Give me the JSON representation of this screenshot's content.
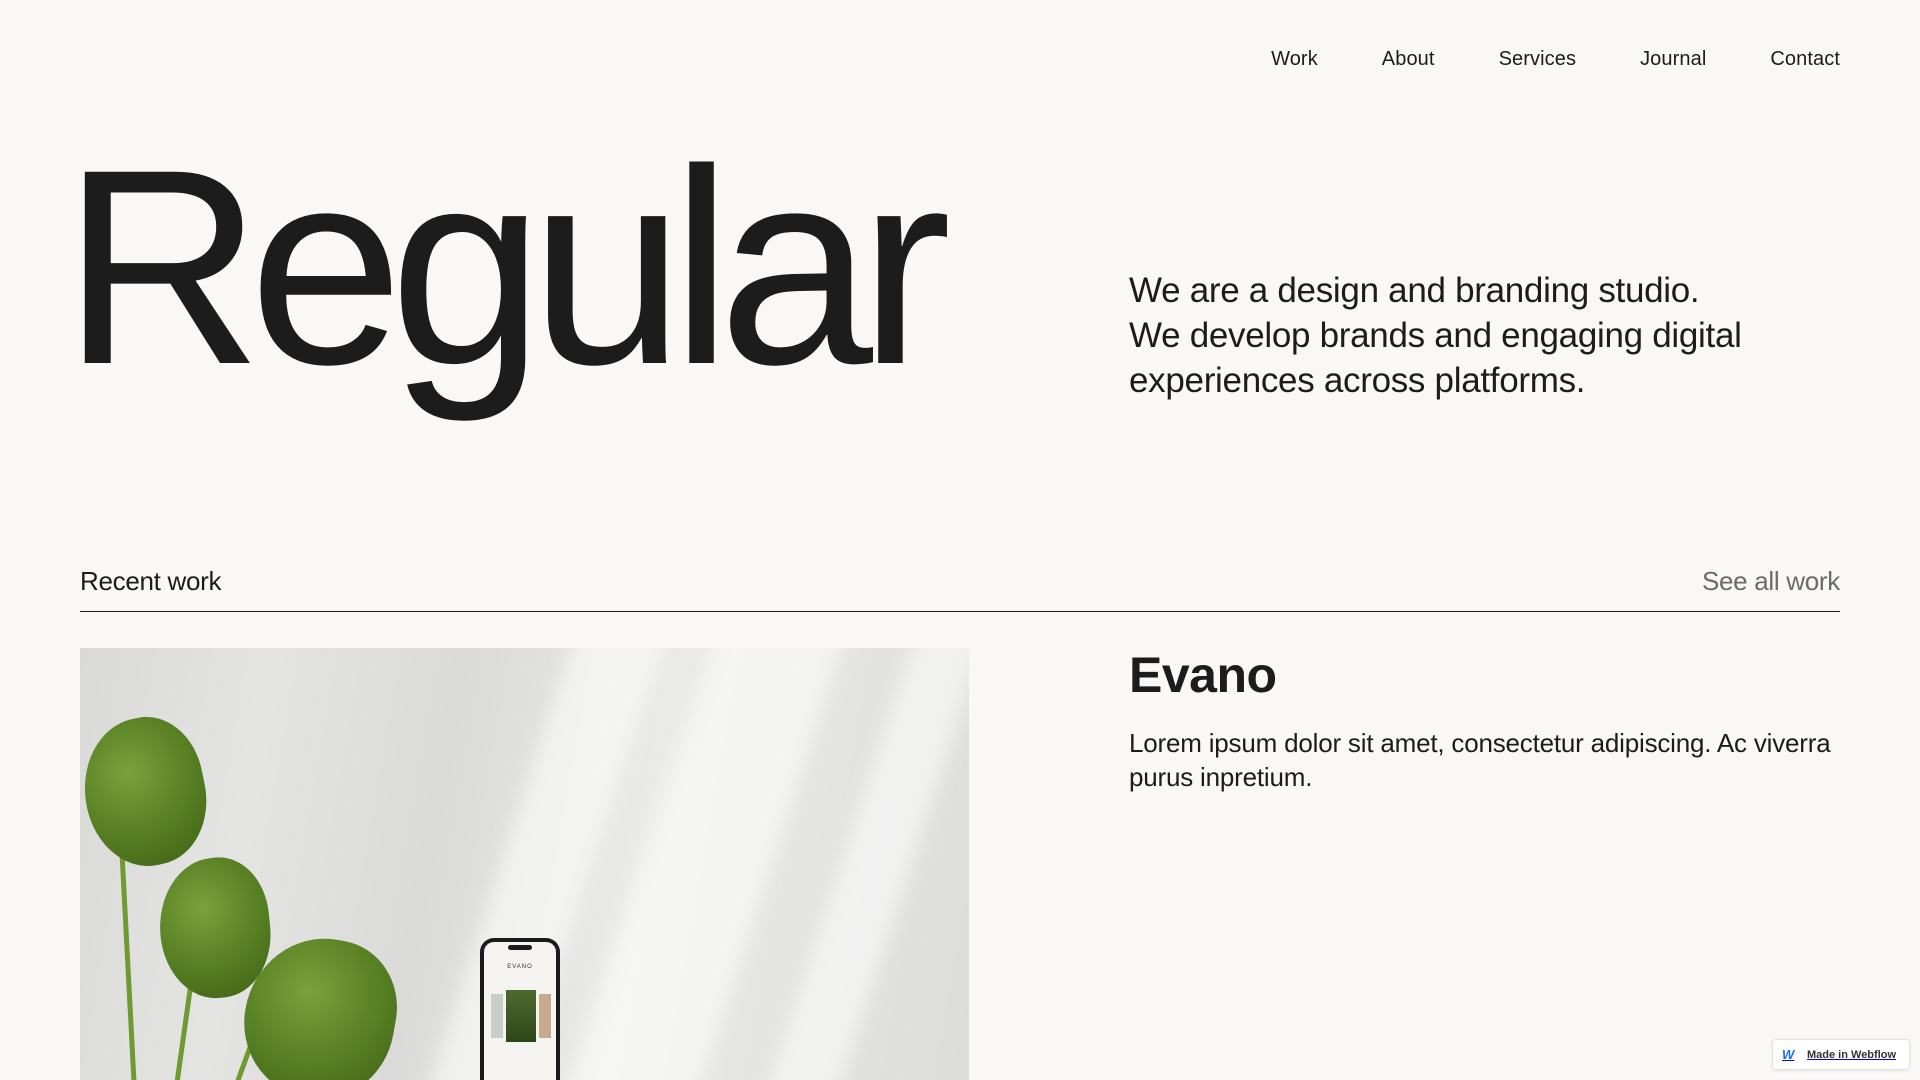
{
  "nav": {
    "items": [
      {
        "label": "Work"
      },
      {
        "label": "About"
      },
      {
        "label": "Services"
      },
      {
        "label": "Journal"
      },
      {
        "label": "Contact"
      }
    ]
  },
  "hero": {
    "title": "Regular",
    "lines": [
      "We are a design and branding studio.",
      "We develop brands and engaging digital",
      "experiences across platforms."
    ]
  },
  "recent_work": {
    "label": "Recent work",
    "see_all": "See all work"
  },
  "project": {
    "title": "Evano",
    "description_lines": [
      "Lorem ipsum dolor sit amet, consectetur adipiscing. Ac viverra",
      "purus inpretium."
    ],
    "phone_brand": "EVANO"
  },
  "badge": {
    "label": "Made in Webflow",
    "icon": "webflow-logo-icon",
    "accent": "#146ef5"
  },
  "colors": {
    "background": "#f9f8f6",
    "text": "#1c1c1c",
    "muted": "#6b6b6b"
  }
}
